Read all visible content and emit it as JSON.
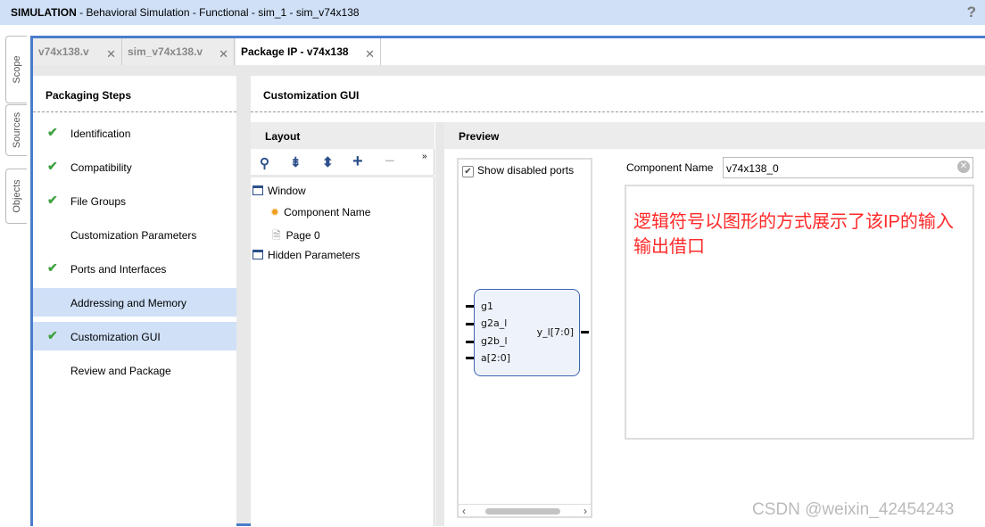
{
  "titlebar": {
    "mode": "SIMULATION",
    "rest": " - Behavioral Simulation - Functional - sim_1 - sim_v74x138",
    "help": "?"
  },
  "side_tabs": [
    "Scope",
    "Sources",
    "Objects"
  ],
  "tabs": [
    {
      "label": "v74x138.v"
    },
    {
      "label": "sim_v74x138.v"
    },
    {
      "label": "Package IP - v74x138"
    }
  ],
  "packaging": {
    "title": "Packaging Steps",
    "steps": [
      {
        "label": "Identification",
        "done": true
      },
      {
        "label": "Compatibility",
        "done": true
      },
      {
        "label": "File Groups",
        "done": true
      },
      {
        "label": "Customization Parameters",
        "done": false
      },
      {
        "label": "Ports and Interfaces",
        "done": true
      },
      {
        "label": "Addressing and Memory",
        "done": false
      },
      {
        "label": "Customization GUI",
        "done": true
      },
      {
        "label": "Review and Package",
        "done": false
      }
    ]
  },
  "gui": {
    "title": "Customization GUI",
    "layout": {
      "title": "Layout",
      "tree": [
        "Window",
        "Component Name",
        "Page 0",
        "Hidden Parameters"
      ]
    },
    "preview": {
      "title": "Preview",
      "show_disabled": "Show disabled ports",
      "component_label": "Component Name",
      "component_value": "v74x138_0",
      "inputs": [
        "g1",
        "g2a_l",
        "g2b_l",
        "a[2:0]"
      ],
      "output": "y_l[7:0]"
    }
  },
  "annotation": "逻辑符号以图形的方式展示了该IP的输入输出借口",
  "watermark": "CSDN @weixin_42454243",
  "colors": {
    "accent": "#4a7ccc",
    "selection": "#cfe0f7",
    "check": "#3fa33f",
    "annotation": "#ff2a2a"
  }
}
